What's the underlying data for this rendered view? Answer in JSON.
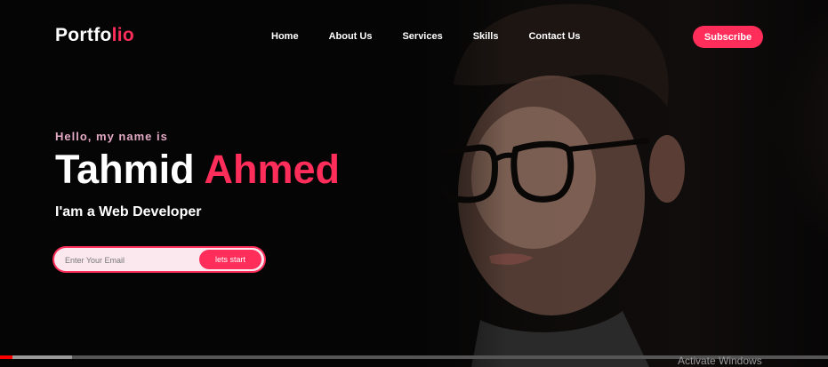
{
  "brand": {
    "prefix": "Portfo",
    "accent": "lio",
    "accent_color": "#ff2d5a"
  },
  "nav": {
    "items": [
      "Home",
      "About Us",
      "Services",
      "Skills",
      "Contact Us"
    ],
    "cta": "Subscribe"
  },
  "hero": {
    "greeting": "Hello, my name is",
    "first_name": "Tahmid",
    "last_name": "Ahmed",
    "role": "I'am a Web Developer",
    "email_placeholder": "Enter Your Email",
    "button": "lets start"
  },
  "video": {
    "played_fraction": 0.015,
    "buffered_fraction": 0.087
  },
  "os_watermark": "Activate Windows"
}
